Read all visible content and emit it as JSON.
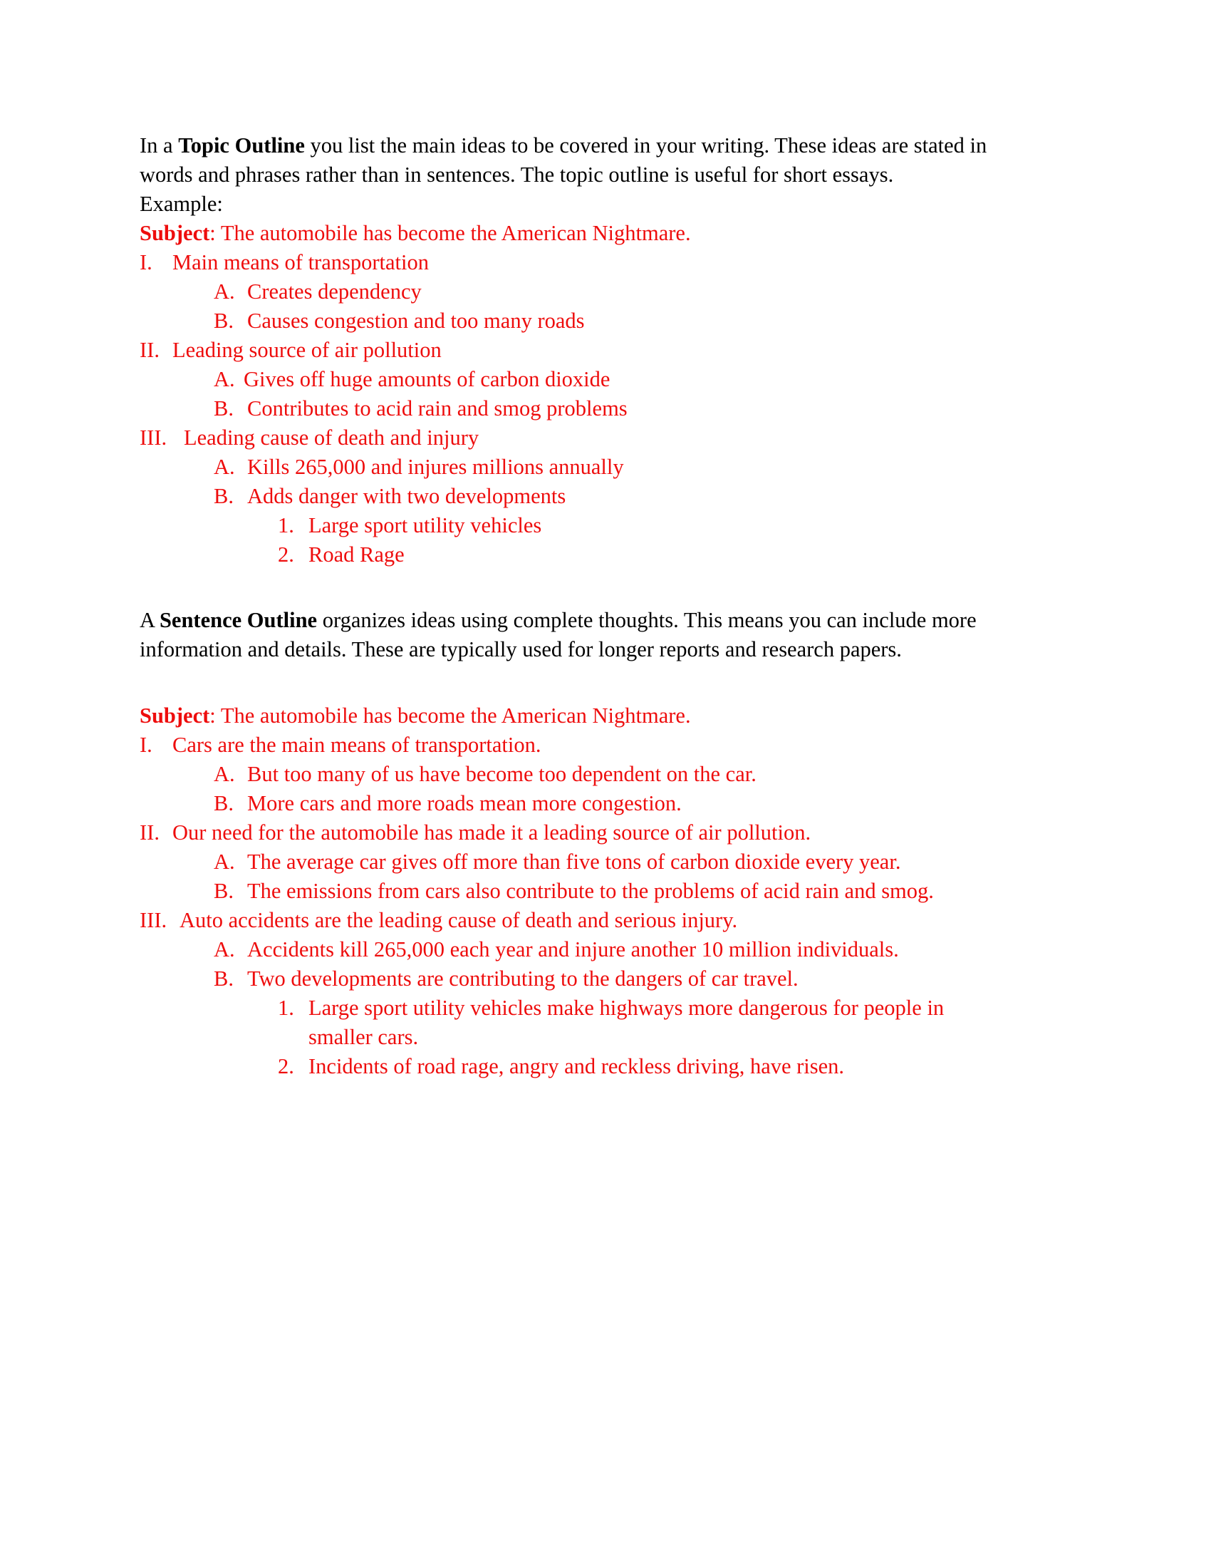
{
  "document": {
    "background_color": "#ffffff",
    "body_text_color": "#000000",
    "outline_text_color": "#ee0d0d",
    "intro": {
      "lead_plain_1": "In a ",
      "lead_bold": "Topic Outline",
      "lead_plain_2": " you list the main ideas to be covered in your writing.  These ideas are stated in words and phrases rather than in sentences.  The topic outline is useful for short essays.",
      "example_label": "Example:"
    },
    "topic_outline": {
      "subject_label": "Subject",
      "subject_rest": ": The automobile has become the American Nightmare.",
      "items": [
        {
          "level": 1,
          "marker": "I.",
          "text": "Main means of transportation"
        },
        {
          "level": 2,
          "marker": "A.",
          "text": "Creates dependency"
        },
        {
          "level": 2,
          "marker": "B.",
          "text": "Causes congestion and too many roads"
        },
        {
          "level": 1,
          "marker": "II.",
          "text": "Leading source of air pollution"
        },
        {
          "level": 2,
          "marker": "A.",
          "text": "Gives off huge amounts of carbon dioxide"
        },
        {
          "level": 2,
          "marker": "B.",
          "text": "Contributes to acid rain and smog problems"
        },
        {
          "level": 1,
          "marker": "III.",
          "text": "Leading cause of death and injury"
        },
        {
          "level": 2,
          "marker": "A.",
          "text": "Kills 265,000 and injures millions annually"
        },
        {
          "level": 2,
          "marker": "B.",
          "text": "Adds danger with two developments"
        },
        {
          "level": 3,
          "marker": "1.",
          "text": "Large sport utility vehicles"
        },
        {
          "level": 3,
          "marker": "2.",
          "text": "Road Rage"
        }
      ]
    },
    "sentence_intro": {
      "lead_plain_1": "A ",
      "lead_bold": "Sentence Outline",
      "lead_plain_2": " organizes ideas using complete thoughts. This means you can include more information and details.  These are typically used for longer reports and research papers."
    },
    "sentence_outline": {
      "subject_label": "Subject",
      "subject_rest": ": The automobile has become the American Nightmare.",
      "items": [
        {
          "level": 1,
          "marker": "I.",
          "text": "Cars are the main means of transportation."
        },
        {
          "level": 2,
          "marker": "A.",
          "text": "But too many of us have become too dependent on the car."
        },
        {
          "level": 2,
          "marker": "B.",
          "text": "More cars and more roads mean more congestion."
        },
        {
          "level": 1,
          "marker": "II.",
          "text": "Our need for the automobile has made it a leading source of air pollution."
        },
        {
          "level": 2,
          "marker": "A.",
          "text": "The average car gives off more than five tons of carbon dioxide every year."
        },
        {
          "level": 2,
          "marker": "B.",
          "text": "The emissions from cars also contribute to the problems of acid rain and smog."
        },
        {
          "level": 1,
          "marker": "III.",
          "text": "Auto accidents are the leading cause of death and serious injury."
        },
        {
          "level": 2,
          "marker": "A.",
          "text": "Accidents kill 265,000 each year and injure another 10 million individuals."
        },
        {
          "level": 2,
          "marker": "B.",
          "text": "Two developments are contributing to the dangers of car travel."
        },
        {
          "level": 3,
          "marker": "1.",
          "text": "Large sport utility vehicles make highways more dangerous for people in smaller cars."
        },
        {
          "level": 3,
          "marker": "2.",
          "text": "Incidents of road rage, angry and reckless driving, have risen."
        }
      ]
    }
  }
}
